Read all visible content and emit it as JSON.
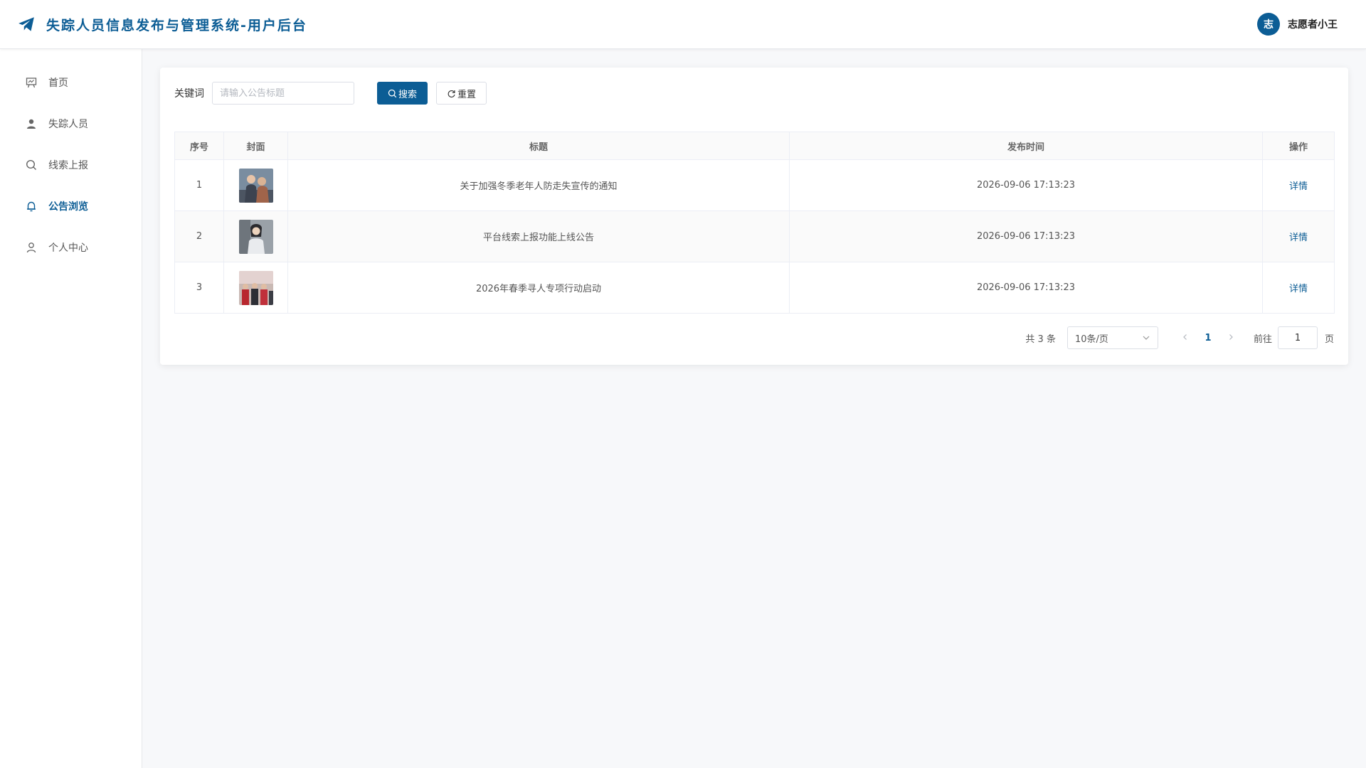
{
  "header": {
    "title": "失踪人员信息发布与管理系统-用户后台",
    "user": {
      "avatar_text": "志",
      "name": "志愿者小王"
    }
  },
  "sidebar": {
    "items": [
      {
        "label": "首页",
        "icon": "presentation-board-icon"
      },
      {
        "label": "失踪人员",
        "icon": "person-icon"
      },
      {
        "label": "线索上报",
        "icon": "search-icon"
      },
      {
        "label": "公告浏览",
        "icon": "bell-icon",
        "active": true
      },
      {
        "label": "个人中心",
        "icon": "user-outline-icon"
      }
    ]
  },
  "toolbar": {
    "keyword_label": "关键词",
    "search_placeholder": "请输入公告标题",
    "search_value": "",
    "search_button": "搜索",
    "reset_button": "重置"
  },
  "table": {
    "columns": [
      "序号",
      "封面",
      "标题",
      "发布时间",
      "操作"
    ],
    "rows": [
      {
        "index": "1",
        "title": "关于加强冬季老年人防走失宣传的通知",
        "time": "2026-09-06 17:13:23",
        "action": "详情"
      },
      {
        "index": "2",
        "title": "平台线索上报功能上线公告",
        "time": "2026-09-06 17:13:23",
        "action": "详情"
      },
      {
        "index": "3",
        "title": "2026年春季寻人专项行动启动",
        "time": "2026-09-06 17:13:23",
        "action": "详情"
      }
    ]
  },
  "pagination": {
    "total_text": "共 3 条",
    "page_size": "10条/页",
    "current_page": "1",
    "goto_label": "前往",
    "goto_value": "1",
    "page_unit": "页"
  },
  "colors": {
    "accent": "#0c5d95",
    "background": "#f7f8fa"
  }
}
